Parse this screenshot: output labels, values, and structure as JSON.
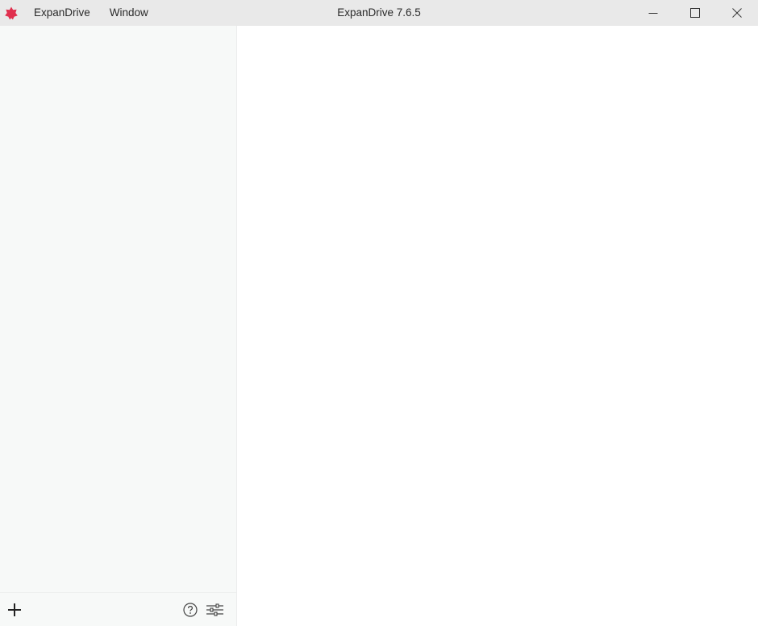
{
  "window": {
    "title": "ExpanDrive 7.6.5",
    "app_icon": "expandrive-logo-icon",
    "controls": [
      "minimize-icon",
      "maximize-icon",
      "close-icon"
    ]
  },
  "menu": {
    "items": [
      {
        "label": "ExpanDrive"
      },
      {
        "label": "Window"
      }
    ]
  },
  "sidebar": {
    "footer": {
      "add_icon": "plus-icon",
      "help_icon": "help-circle-icon",
      "settings_icon": "sliders-icon"
    }
  },
  "colors": {
    "brand": "#e0304e",
    "titlebar": "#e9e9e9",
    "sidebar": "#f7f9f8"
  }
}
